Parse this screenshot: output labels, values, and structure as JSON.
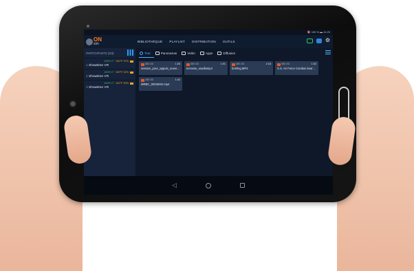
{
  "status": {
    "text": "🔇 100 % ▬ 11:20"
  },
  "app": {
    "logo_top": "ON",
    "logo_bottom": "sim"
  },
  "topnav": [
    "BIBLIOTHÈQUE",
    "PLAYLIST",
    "DISTRIBUTION",
    "OUTILS"
  ],
  "sidebar": {
    "header": "PARTICIPANTS (3/3)",
    "participants": [
      {
        "index": "1",
        "name": "Showtime VR",
        "pct": "100% C°",
        "temp": "100°F 37%"
      },
      {
        "index": "2",
        "name": "Showtime VR",
        "pct": "100% C°",
        "temp": "100°F 32%"
      },
      {
        "index": "3",
        "name": "Showtime VR",
        "pct": "100% C°",
        "temp": "100°F 30%"
      }
    ]
  },
  "tabs": [
    {
      "label": "Tout",
      "icon": "globe-icon",
      "active": true
    },
    {
      "label": "Panoramas",
      "icon": "panorama-icon",
      "active": false
    },
    {
      "label": "Vidéo",
      "icon": "video-icon",
      "active": false
    },
    {
      "label": "Apps",
      "icon": "apps-icon",
      "active": false
    },
    {
      "label": "Diffusion",
      "icon": "broadcast-icon",
      "active": false
    }
  ],
  "cards": [
    {
      "tag": "360 2D",
      "time": "1:26",
      "title": "session_pour_appuis_ouverte_0..."
    },
    {
      "tag": "360 2D",
      "time": "1:01",
      "title": "terrasse_vaudlamp4"
    },
    {
      "tag": "360 2D",
      "time": "2:18",
      "title": "briefing.MP4"
    },
    {
      "tag": "360 2D",
      "time": "1:32",
      "title": "S.S. Air Force Combat Search a..."
    },
    {
      "tag": "180 2D",
      "time": "1:42",
      "title": "MRBC_00040HE.mp4"
    }
  ],
  "colors": {
    "accent": "#4fb0ff",
    "brand": "#ff7a1a",
    "background": "#0e1829"
  }
}
